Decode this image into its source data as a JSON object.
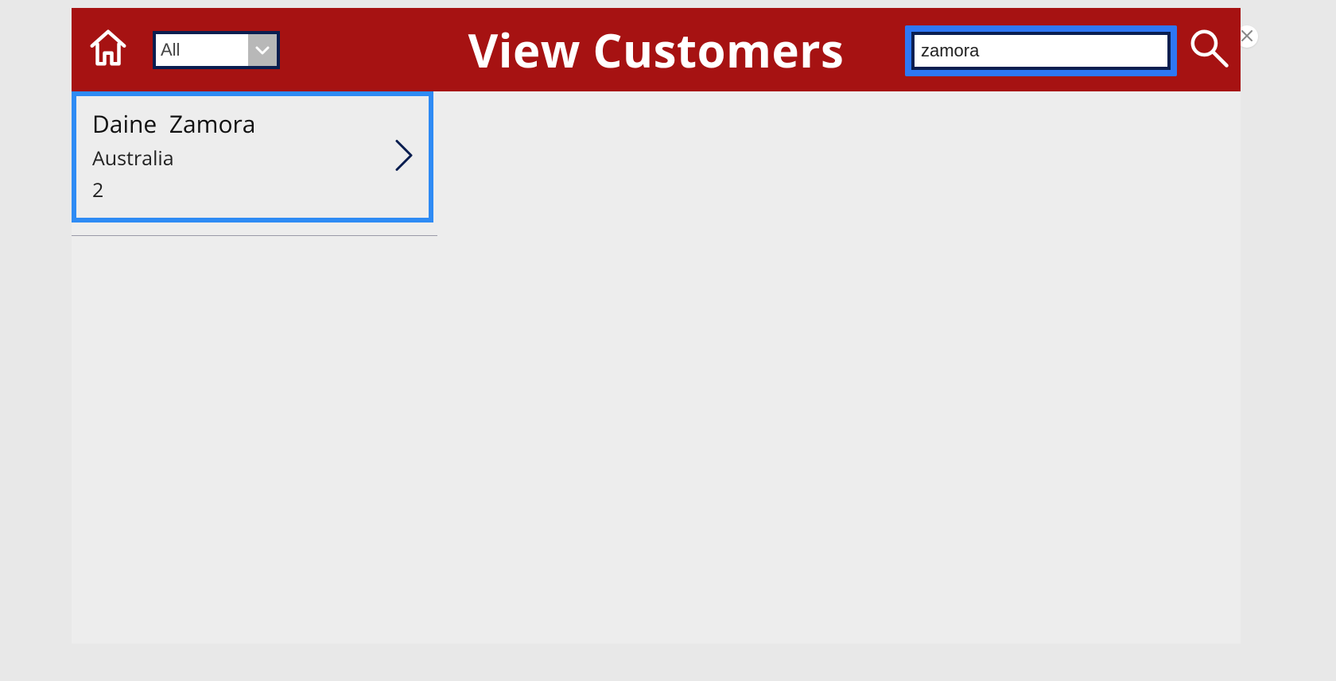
{
  "header": {
    "title": "View Customers",
    "filter": {
      "value": "All"
    },
    "search": {
      "value": "zamora"
    }
  },
  "results": [
    {
      "name": "Daine  Zamora",
      "country": "Australia",
      "count": "2"
    }
  ]
}
